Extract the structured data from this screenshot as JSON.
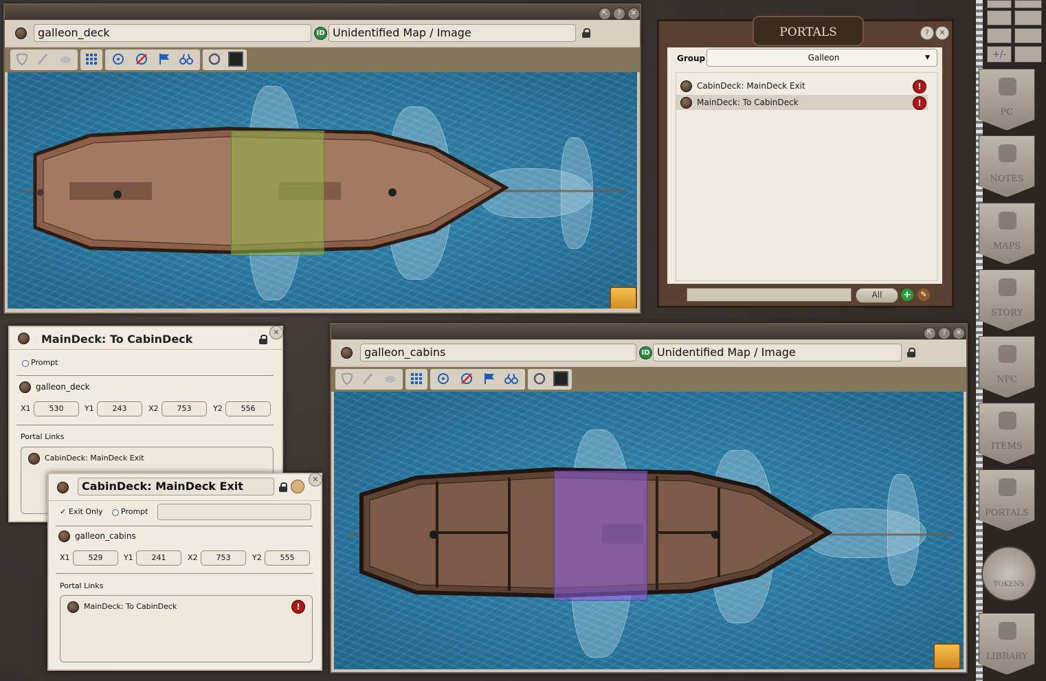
{
  "deck_window": {
    "title": "galleon_deck",
    "id_badge": "ID",
    "map_type": "Unidentified Map / Image",
    "controls": [
      "resize-icon",
      "help",
      "close"
    ],
    "zone_color": "#8fb34a"
  },
  "cabins_window": {
    "title": "galleon_cabins",
    "id_badge": "ID",
    "map_type": "Unidentified Map / Image",
    "zone_color": "#8a5cd6"
  },
  "portals_panel": {
    "header": "PORTALS",
    "group_label": "Group",
    "group_value": "Galleon",
    "items": [
      {
        "label": "CabinDeck: MainDeck Exit"
      },
      {
        "label": "MainDeck: To CabinDeck"
      }
    ],
    "filter_button": "All"
  },
  "record_maindeck": {
    "title": "MainDeck: To CabinDeck",
    "prompt_label": "Prompt",
    "map": "galleon_deck",
    "x1_label": "X1",
    "x1": "530",
    "y1_label": "Y1",
    "y1": "243",
    "x2_label": "X2",
    "x2": "753",
    "y2_label": "Y2",
    "y2": "556",
    "links_label": "Portal Links",
    "links": [
      "CabinDeck: MainDeck Exit"
    ]
  },
  "record_cabindeck": {
    "title": "CabinDeck: MainDeck Exit",
    "exit_only_label": "Exit Only",
    "prompt_label": "Prompt",
    "map": "galleon_cabins",
    "x1_label": "X1",
    "x1": "529",
    "y1_label": "Y1",
    "y1": "241",
    "x2_label": "X2",
    "x2": "753",
    "y2_label": "Y2",
    "y2": "555",
    "links_label": "Portal Links",
    "links": [
      "MainDeck: To CabinDeck"
    ]
  },
  "sidebar": {
    "top_buttons": [
      "+/-"
    ],
    "tabs": [
      "PC",
      "NOTES",
      "MAPS",
      "STORY",
      "NPC",
      "ITEMS",
      "PORTALS",
      "TOKENS",
      "LIBRARY"
    ]
  },
  "colors": {
    "warning": "#b01515",
    "id_badge": "#2f8a3a",
    "toolbar": "#84775a",
    "sea": "#2d7fa8"
  }
}
